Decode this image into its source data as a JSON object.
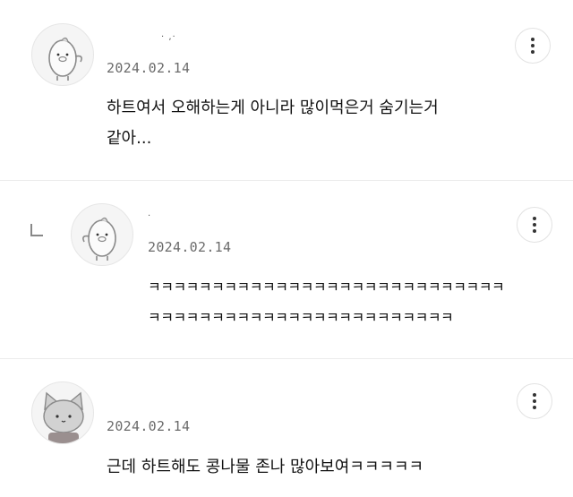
{
  "comments": [
    {
      "username": "· ,·",
      "date": "2024.02.14",
      "text": "하트여서 오해하는게 아니라 많이먹은거 숨기는거\n같아...",
      "avatar": "penguin-bird-avatar"
    },
    {
      "username": "·",
      "date": "2024.02.14",
      "text": "ㅋㅋㅋㅋㅋㅋㅋㅋㅋㅋㅋㅋㅋㅋㅋㅋㅋㅋㅋㅋㅋㅋㅋㅋㅋㅋㅋㅋ\nㅋㅋㅋㅋㅋㅋㅋㅋㅋㅋㅋㅋㅋㅋㅋㅋㅋㅋㅋㅋㅋㅋㅋㅋ",
      "avatar": "penguin-bird-avatar",
      "is_reply": true
    },
    {
      "username": "",
      "date": "2024.02.14",
      "text": "근데 하트해도 콩나물 존나 많아보여ㅋㅋㅋㅋㅋ",
      "avatar": "gray-cat-avatar"
    }
  ],
  "icons": {
    "more": "more-vertical-icon",
    "reply": "reply-corner-icon"
  }
}
